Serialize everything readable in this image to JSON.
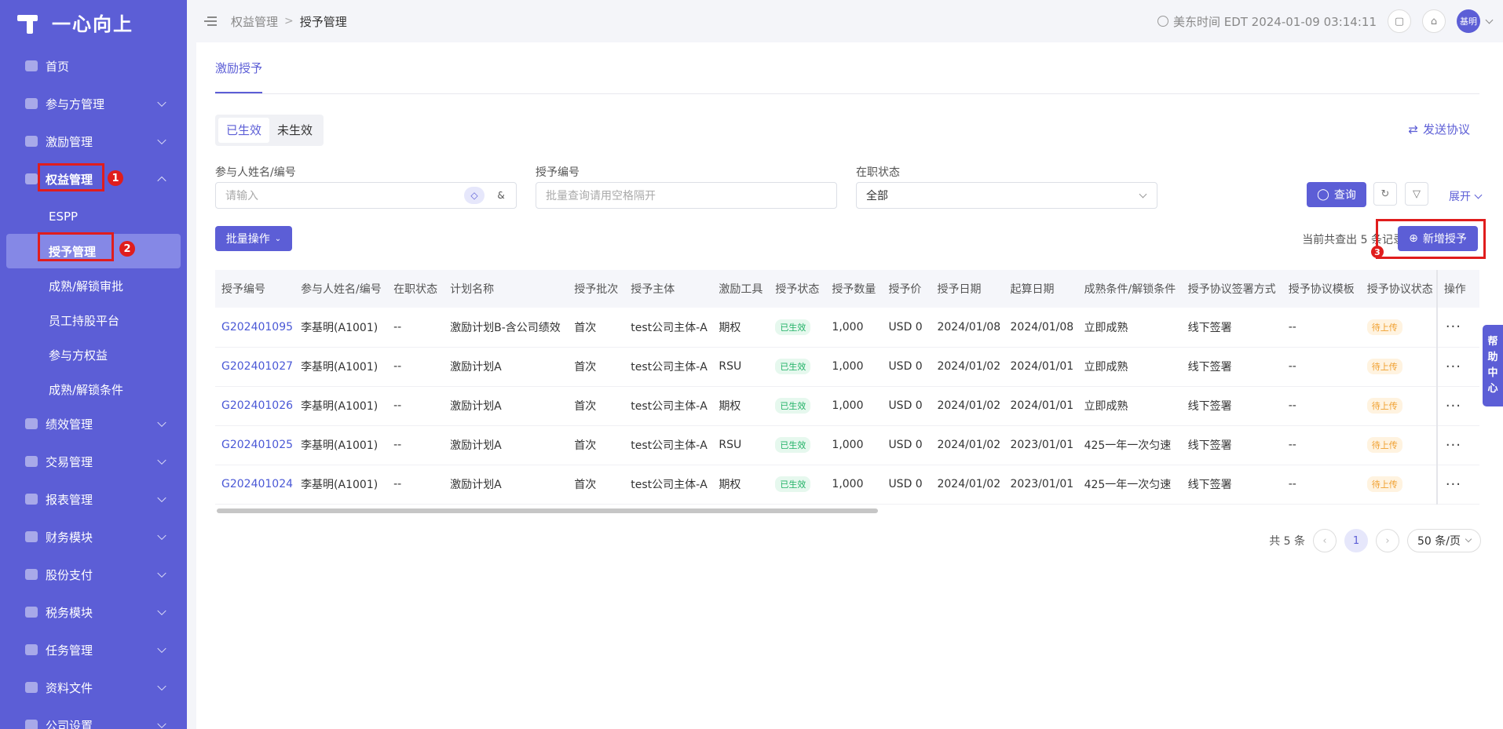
{
  "brand": {
    "name": "一心向上"
  },
  "sidebar": {
    "items": [
      {
        "label": "首页",
        "icon": "home-icon",
        "expand": "none"
      },
      {
        "label": "参与方管理",
        "icon": "people-icon",
        "expand": "down"
      },
      {
        "label": "激励管理",
        "icon": "incentive-icon",
        "expand": "down"
      },
      {
        "label": "权益管理",
        "icon": "equity-icon",
        "expand": "up"
      },
      {
        "label": "绩效管理",
        "icon": "performance-icon",
        "expand": "down"
      },
      {
        "label": "交易管理",
        "icon": "trade-icon",
        "expand": "down"
      },
      {
        "label": "报表管理",
        "icon": "report-icon",
        "expand": "down"
      },
      {
        "label": "财务模块",
        "icon": "finance-icon",
        "expand": "down"
      },
      {
        "label": "股份支付",
        "icon": "share-payment-icon",
        "expand": "down"
      },
      {
        "label": "税务模块",
        "icon": "tax-icon",
        "expand": "down"
      },
      {
        "label": "任务管理",
        "icon": "task-icon",
        "expand": "down"
      },
      {
        "label": "资料文件",
        "icon": "file-icon",
        "expand": "down"
      },
      {
        "label": "公司设置",
        "icon": "company-settings-icon",
        "expand": "down"
      }
    ],
    "equity_sub": [
      "ESPP",
      "授予管理",
      "成熟/解锁审批",
      "员工持股平台",
      "参与方权益",
      "成熟/解锁条件"
    ],
    "markers": [
      "1",
      "2",
      "3"
    ]
  },
  "header": {
    "breadcrumb_parent": "权益管理",
    "breadcrumb_sep": ">",
    "breadcrumb_current": "授予管理",
    "time": "美东时间 EDT 2024-01-09 03:14:11",
    "avatar": "基明"
  },
  "main": {
    "tab": "激励授予",
    "seg": [
      "已生效",
      "未生效"
    ],
    "send_agreement": "发送协议",
    "filters": {
      "name_label": "参与人姓名/编号",
      "name_placeholder": "请输入",
      "grant_label": "授予编号",
      "grant_placeholder": "批量查询请用空格隔开",
      "status_label": "在职状态",
      "status_value": "全部"
    },
    "query_btn": "查询",
    "expand": "展开",
    "batch_btn": "批量操作",
    "count_text": "当前共查出 5 条记录",
    "new_grant_btn": "新增授予"
  },
  "table": {
    "columns": [
      "授予编号",
      "参与人姓名/编号",
      "在职状态",
      "计划名称",
      "授予批次",
      "授予主体",
      "激励工具",
      "授予状态",
      "授予数量",
      "授予价",
      "授予日期",
      "起算日期",
      "成熟条件/解锁条件",
      "授予协议签署方式",
      "授予协议模板",
      "授予协议状态",
      "操作"
    ],
    "rows": [
      [
        "G202401095",
        "李基明(A1001)",
        "--",
        "激励计划B-含公司绩效",
        "首次",
        "test公司主体-A",
        "期权",
        "已生效",
        "1,000",
        "USD  0",
        "2024/01/08",
        "2024/01/08",
        "立即成熟",
        "线下签署",
        "--",
        "待上传",
        "···"
      ],
      [
        "G202401027",
        "李基明(A1001)",
        "--",
        "激励计划A",
        "首次",
        "test公司主体-A",
        "RSU",
        "已生效",
        "1,000",
        "USD  0",
        "2024/01/02",
        "2024/01/01",
        "立即成熟",
        "线下签署",
        "--",
        "待上传",
        "···"
      ],
      [
        "G202401026",
        "李基明(A1001)",
        "--",
        "激励计划A",
        "首次",
        "test公司主体-A",
        "期权",
        "已生效",
        "1,000",
        "USD  0",
        "2024/01/02",
        "2024/01/01",
        "立即成熟",
        "线下签署",
        "--",
        "待上传",
        "···"
      ],
      [
        "G202401025",
        "李基明(A1001)",
        "--",
        "激励计划A",
        "首次",
        "test公司主体-A",
        "RSU",
        "已生效",
        "1,000",
        "USD  0",
        "2024/01/02",
        "2023/01/01",
        "425一年一次匀速",
        "线下签署",
        "--",
        "待上传",
        "···"
      ],
      [
        "G202401024",
        "李基明(A1001)",
        "--",
        "激励计划A",
        "首次",
        "test公司主体-A",
        "期权",
        "已生效",
        "1,000",
        "USD  0",
        "2024/01/02",
        "2023/01/01",
        "425一年一次匀速",
        "线下签署",
        "--",
        "待上传",
        "···"
      ]
    ]
  },
  "pagination": {
    "total": "共 5 条",
    "page": "1",
    "size": "50 条/页"
  },
  "help": [
    "帮",
    "助",
    "中",
    "心"
  ],
  "colors": {
    "primary": "#5c5ed6",
    "highlight": "#e01d1d"
  }
}
